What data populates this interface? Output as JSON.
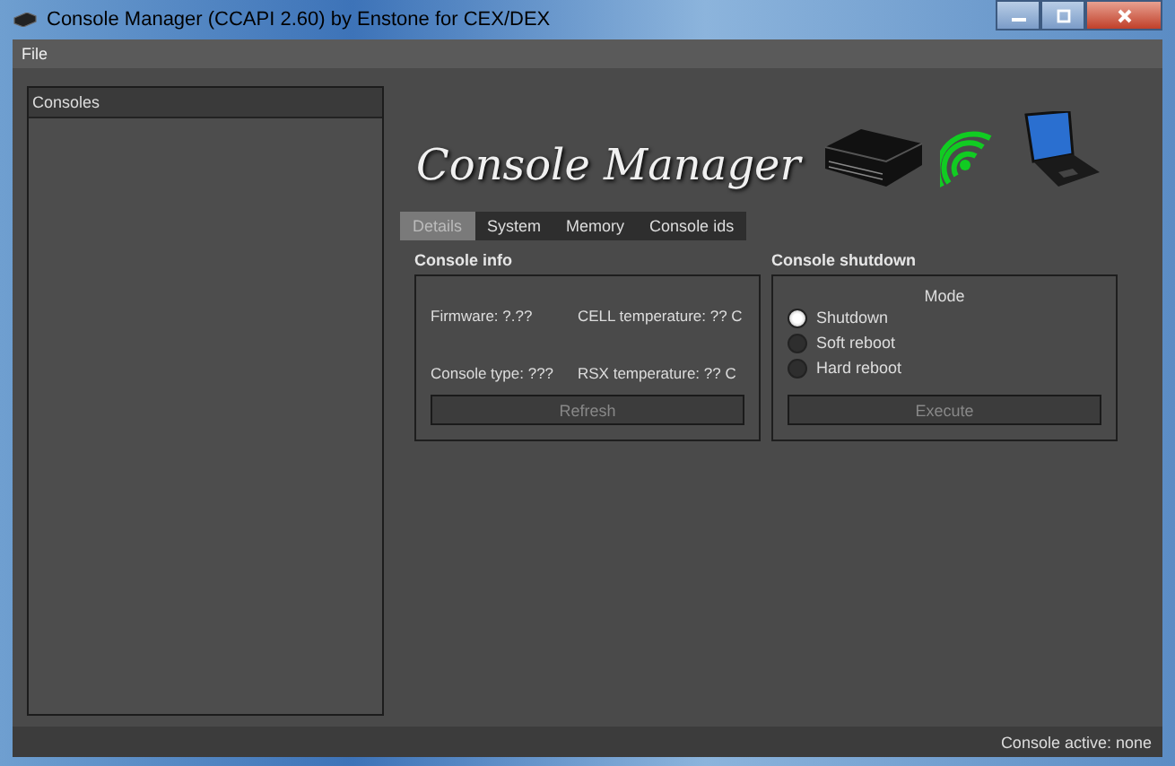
{
  "window": {
    "title": "Console Manager (CCAPI 2.60) by Enstone for CEX/DEX"
  },
  "menu": [
    "File"
  ],
  "consoles_panel": {
    "title": "Consoles"
  },
  "logo": {
    "text": "Console Manager"
  },
  "tabs": [
    {
      "label": "Details",
      "selected": true
    },
    {
      "label": "System",
      "selected": false
    },
    {
      "label": "Memory",
      "selected": false
    },
    {
      "label": "Console ids",
      "selected": false
    }
  ],
  "console_info": {
    "title": "Console info",
    "fields": [
      "Firmware: ?.??",
      "CELL temperature: ?? C",
      "Console type: ???",
      "RSX temperature: ?? C"
    ],
    "button": {
      "label": "Refresh",
      "disabled": true
    }
  },
  "console_shutdown": {
    "title": "Console shutdown",
    "mode_label": "Mode",
    "options": [
      {
        "label": "Shutdown",
        "selected": true
      },
      {
        "label": "Soft reboot",
        "selected": false
      },
      {
        "label": "Hard reboot",
        "selected": false
      }
    ],
    "button": {
      "label": "Execute",
      "disabled": true
    }
  },
  "status_bar": "Console active: none"
}
